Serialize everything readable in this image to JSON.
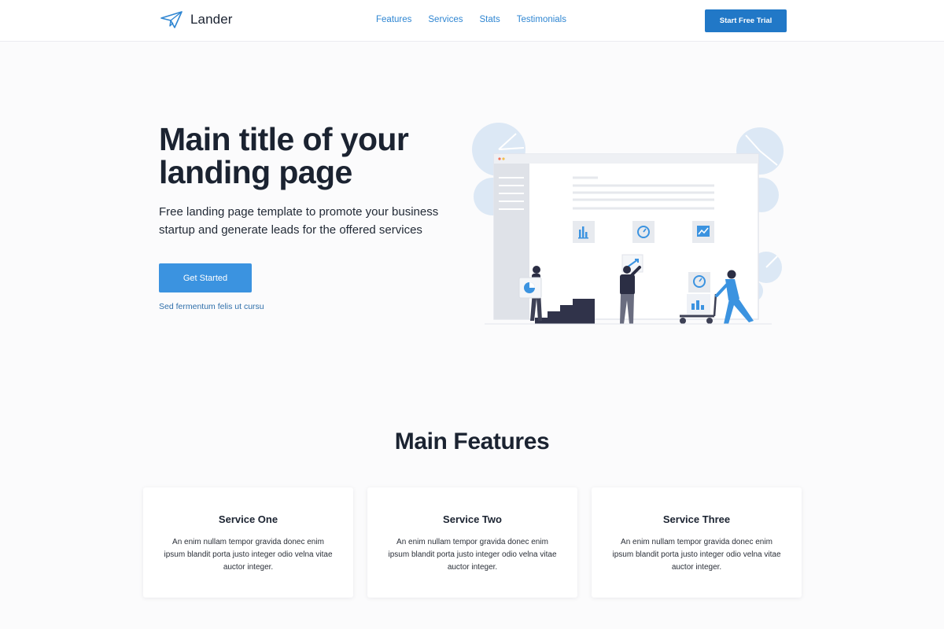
{
  "brand": {
    "name": "Lander",
    "logo_icon": "paper-plane-icon",
    "accent": "#2178c7"
  },
  "nav": {
    "items": [
      {
        "label": "Features"
      },
      {
        "label": "Services"
      },
      {
        "label": "Stats"
      },
      {
        "label": "Testimonials"
      }
    ],
    "cta_label": "Start Free Trial"
  },
  "hero": {
    "title": "Main title of your landing page",
    "subtitle": "Free landing page template to promote your business startup and generate leads for the offered services",
    "button_label": "Get Started",
    "link_text": "Sed fermentum felis ut cursu",
    "illustration": "team-building-dashboard-illustration"
  },
  "features": {
    "title": "Main Features",
    "cards": [
      {
        "title": "Service One",
        "text": "An enim nullam tempor gravida donec enim ipsum blandit porta justo integer odio velna vitae auctor integer."
      },
      {
        "title": "Service Two",
        "text": "An enim nullam tempor gravida donec enim ipsum blandit porta justo integer odio velna vitae auctor integer."
      },
      {
        "title": "Service Three",
        "text": "An enim nullam tempor gravida donec enim ipsum blandit porta justo integer odio velna vitae auctor integer."
      }
    ]
  }
}
